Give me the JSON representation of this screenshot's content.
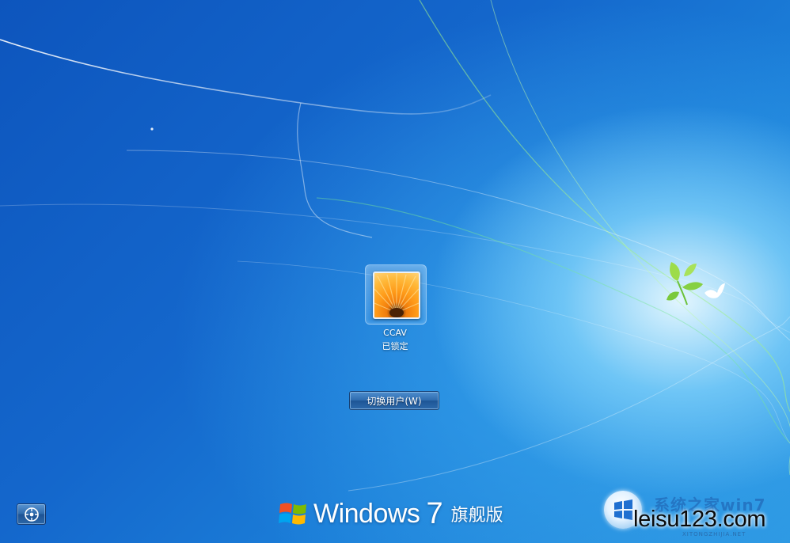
{
  "user": {
    "name": "CCAV",
    "status": "已锁定"
  },
  "actions": {
    "switch_user_label": "切换用户(W)"
  },
  "brand": {
    "word": "Windows",
    "version": "7",
    "edition": "旗舰版"
  },
  "watermark": {
    "title": "系统之家win7",
    "text": "leisu123.com",
    "subtitle": "XITONGZHIJIA.NET"
  },
  "icons": {
    "ease_of_access": "ease-of-access-icon",
    "windows_flag": "windows-flag-icon",
    "bird": "dove-icon",
    "leaves": "leaf-icon"
  },
  "colors": {
    "background": "#1565c8",
    "glow": "#e6f8ff",
    "button": "#2d6aad"
  }
}
